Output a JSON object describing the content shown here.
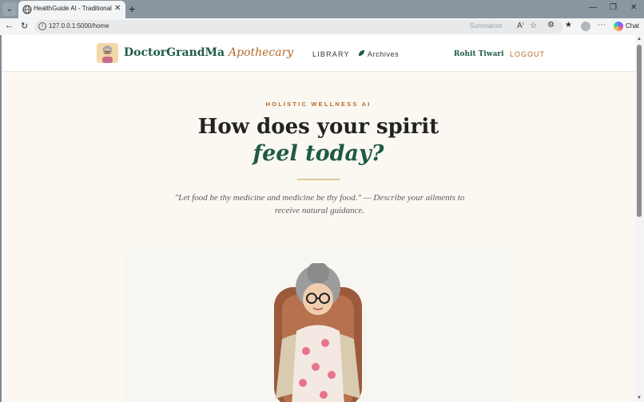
{
  "browser": {
    "tab_title": "HealthGuide AI - Traditional Apoth",
    "url": "127.0.0.1:5000/home",
    "summarize_label": "Summarize",
    "chat_label": "Chat",
    "icons": {
      "tab_menu": "chevron-down-icon",
      "tab_favicon": "globe-icon",
      "tab_close": "close-icon",
      "new_tab": "plus-icon",
      "back": "arrow-left-icon",
      "reload": "reload-icon",
      "info": "info-icon",
      "read_aloud": "read-aloud-icon",
      "favorite": "star-icon",
      "extensions": "puzzle-icon",
      "favorites_bar": "favorites-icon",
      "profile": "profile-icon",
      "more": "more-icon",
      "copilot": "copilot-icon"
    }
  },
  "header": {
    "brand_main": "DoctorGrandMa",
    "brand_accent": "Apothecary",
    "nav_library": "LIBRARY",
    "nav_archives": "Archives",
    "user_name": "Rohit Tiwari",
    "logout": "LOGOUT"
  },
  "hero": {
    "eyebrow": "HOLISTIC WELLNESS AI",
    "title_line1": "How does your spirit",
    "title_line2": "feel today?",
    "quote_line1": "\"Let food be thy medicine and medicine be thy food.\" — Describe your ailments to",
    "quote_line2": "receive natural guidance."
  },
  "colors": {
    "brand_green": "#1f5a45",
    "accent_brown": "#b46a2a",
    "page_bg": "#fbf8f2",
    "divider": "#e3c79f"
  }
}
